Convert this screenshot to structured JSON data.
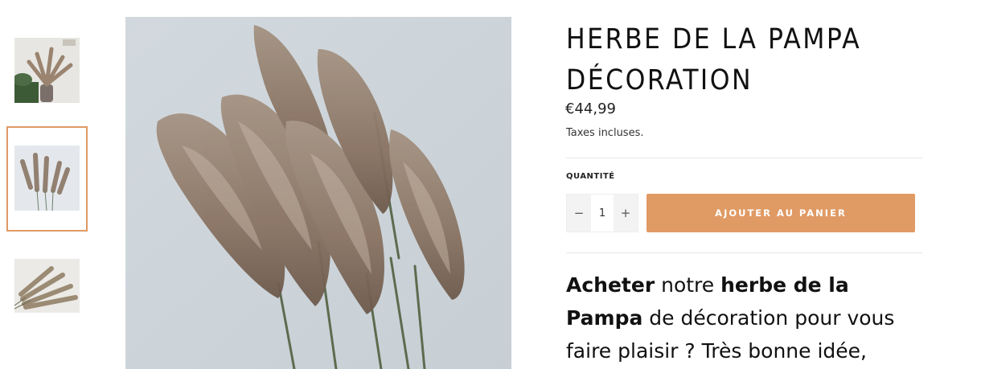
{
  "product": {
    "title_line1": "HERBE DE LA PAMPA",
    "title_line2": "DÉCORATION",
    "price": "€44,99",
    "taxes_note": "Taxes incluses.",
    "quantity_label": "QUANTITÉ",
    "quantity_value": "1",
    "decrease_symbol": "−",
    "increase_symbol": "+",
    "add_to_cart_label": "AJOUTER AU PANIER"
  },
  "description": {
    "part1_bold": "Acheter",
    "part2": " notre ",
    "part3_bold": "herbe de la Pampa",
    "part4": " de décoration pour vous faire plaisir ? Très bonne idée,"
  },
  "colors": {
    "accent": "#e09a64",
    "thumb_selected_border": "#e09a64"
  },
  "gallery": {
    "selected_index": 1,
    "thumbnails": [
      "pampas-vase-photo",
      "pampas-white-background-photo",
      "pampas-horizontal-photo"
    ]
  }
}
